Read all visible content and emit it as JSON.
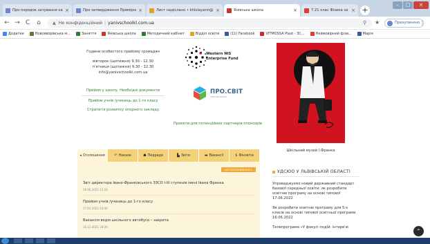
{
  "browser": {
    "tabs": [
      {
        "title": "Про порядок зачування карто",
        "color": "#6b86c9",
        "active": false
      },
      {
        "title": "Про затвердження Примірни",
        "color": "#6b86c9",
        "active": false
      },
      {
        "title": "Лист надіслано • khlolayann@",
        "color": "#e4a126",
        "active": false
      },
      {
        "title": "Янівська школа",
        "color": "#c0392b",
        "active": true
      },
      {
        "title": "7.21 клас Фізика за навчальн",
        "color": "#e53935",
        "active": false
      }
    ],
    "new_tab": "+",
    "back": "←",
    "forward": "→",
    "reload": "C",
    "home": "⌂",
    "security": "Не конфіденційний",
    "url": "yanivschoolkl.com.ua",
    "star": "★",
    "profile_label": "Призупинено",
    "menu": "⋮"
  },
  "bookmarks": [
    {
      "label": "Додатки",
      "color": "#4285f4"
    },
    {
      "label": "Новояворівська м...",
      "color": "#5b7a3a"
    },
    {
      "label": "Заняття",
      "color": "#2e7d32"
    },
    {
      "label": "Янівська школа",
      "color": "#c0392b"
    },
    {
      "label": "Методичний кабінет",
      "color": "#2e7d32"
    },
    {
      "label": "Відділ освіти",
      "color": "#e0a526"
    },
    {
      "label": "(11) Facebook",
      "color": "#3b5998"
    },
    {
      "label": "VITMOSSA Plast - ЗС...",
      "color": "#cc2b2b"
    },
    {
      "label": "Неймовірний фізи...",
      "color": "#e53935"
    },
    {
      "label": "Марія",
      "color": "#3b5998"
    }
  ],
  "left_info": {
    "heading": "Години особистого прийому громадян",
    "line1": "вівторок (щотижня) 9.30 - 12.30",
    "line2": "п'ятниця (щотижня) 9.30 - 12.30",
    "line3": "info@yanivschoolkl.com.ua"
  },
  "links": {
    "admission_docs": "Прийом у школу. Необхідні документи",
    "admission_first": "Прийом учнів /учениць до 1-го класу",
    "strategy": "Стратегія розвитку опорного закладу",
    "partners": "Проекти для потенційних партнерів-спонсорів"
  },
  "fund": {
    "line1": "Western NIS",
    "line2": "Enterprise Fund"
  },
  "prosvit": {
    "name": "ПРО.СВІТ",
    "sub": "освітній проект"
  },
  "poster": {
    "caption": "Шкільний музей І.Франка",
    "colors": {
      "bg": "#d0131e",
      "black": "#111111"
    }
  },
  "news_tabs": [
    {
      "icon": "◂",
      "label": "Оголошення",
      "active": true
    },
    {
      "icon": "↶",
      "label": "Накази",
      "active": false
    },
    {
      "icon": "☗",
      "label": "Педради",
      "active": false
    },
    {
      "icon": "▙",
      "label": "Звіти",
      "active": false
    },
    {
      "icon": "▬",
      "label": "Вакансії",
      "active": false
    },
    {
      "icon": "$",
      "label": "Фінзвіти",
      "active": false
    }
  ],
  "all_news": "УСІ ОГОЛОШЕННЯ »",
  "news": [
    {
      "title": "Звіт директора Івано-Франківського ЗЗСО І-ІІІ ступенів імені Івана Франка",
      "date": "16.06.2022 12:19"
    },
    {
      "title": "Прийом учнів /учениць до 1-го класу",
      "date": "17.01.2022 14:40"
    },
    {
      "title": "Вакансія водія шкільного автобуса – закрита",
      "date": "16.12.2021 19:20"
    }
  ],
  "oblast_news": {
    "heading": "УДСЮО У ЛЬВІВСЬКІЙ ОБЛАСТІ",
    "items": [
      {
        "title": "Упроваджуємо новий державний стандарт базової середньої освіти: як розробити освітню програму на основі типової",
        "date": "17.06.2022"
      },
      {
        "title": "Як розробити освітню програму для 5-х класів на основі типової освітньої програми",
        "date": "16.06.2022"
      },
      {
        "title": "Телепрограма «У фокусі подій: інтерв'ю",
        "date": ""
      }
    ]
  },
  "scroll_top": "⌃",
  "accent_yellow": "#f3d27a",
  "accent_orange": "#f2a93b"
}
